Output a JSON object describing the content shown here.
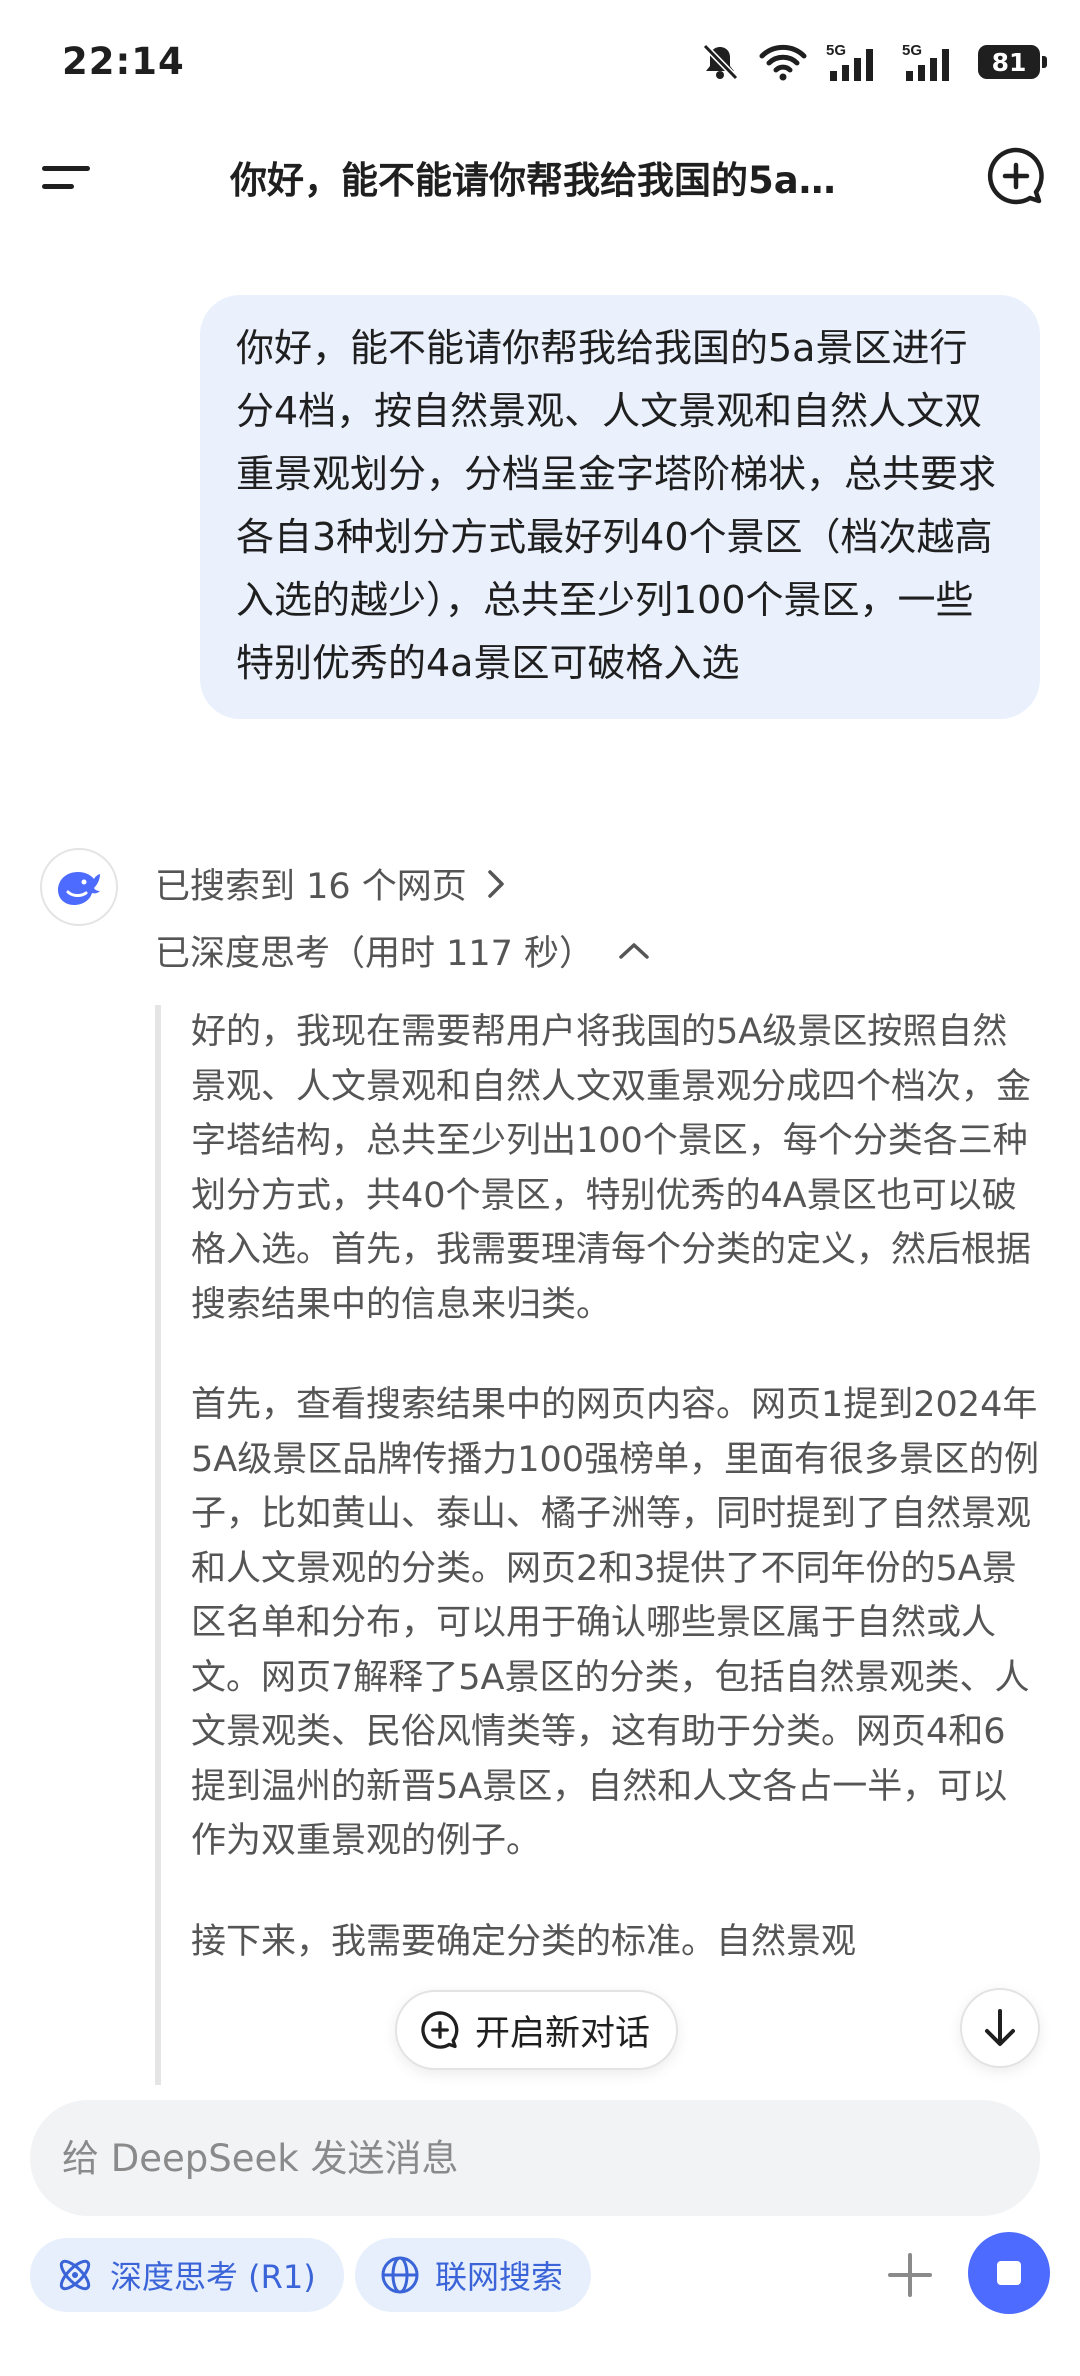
{
  "status_bar": {
    "time": "22:14",
    "battery": "81",
    "network_1": "5G",
    "network_2": "5G",
    "icons": [
      "mute-bell-icon",
      "wifi-icon",
      "signal-icon",
      "signal-icon",
      "battery-icon"
    ]
  },
  "header": {
    "title": "你好，能不能请你帮我给我国的5a景区进行分4档，按自然景观、人文景观和自然人文双重景观划分，分档呈金字塔阶梯状，总共要求各自3种划分方式最好列40个景区（档次越高入选的越少），总共至少列100个景区，一些特别优秀的4a景区可破格入选",
    "menu_icon": "menu-icon",
    "new_chat_icon": "new-chat-icon"
  },
  "user_message": {
    "text": "你好，能不能请你帮我给我国的5a景区进行分4档，按自然景观、人文景观和自然人文双重景观划分，分档呈金字塔阶梯状，总共要求各自3种划分方式最好列40个景区（档次越高入选的越少），总共至少列100个景区，一些特别优秀的4a景区可破格入选"
  },
  "assistant": {
    "search_result": "已搜索到 16 个网页",
    "thinking_label": "已深度思考（用时 117 秒）",
    "thinking_paragraphs": [
      "好的，我现在需要帮用户将我国的5A级景区按照自然景观、人文景观和自然人文双重景观分成四个档次，金字塔结构，总共至少列出100个景区，每个分类各三种划分方式，共40个景区，特别优秀的4A景区也可以破格入选。首先，我需要理清每个分类的定义，然后根据搜索结果中的信息来归类。",
      "首先，查看搜索结果中的网页内容。网页1提到2024年5A级景区品牌传播力100强榜单，里面有很多景区的例子，比如黄山、泰山、橘子洲等，同时提到了自然景观和人文景观的分类。网页2和3提供了不同年份的5A景区名单和分布，可以用于确认哪些景区属于自然或人文。网页7解释了5A景区的分类，包括自然景观类、人文景观类、民俗风情类等，这有助于分类。网页4和6提到温州的新晋5A景区，自然和人文各占一半，可以作为双重景观的例子。",
      "接下来，我需要确定分类的标准。自然景观"
    ]
  },
  "floating": {
    "new_dialog_label": "开启新对话"
  },
  "input": {
    "placeholder": "给 DeepSeek 发送消息"
  },
  "toolbar": {
    "deep_think_label": "深度思考 (R1)",
    "web_search_label": "联网搜索"
  },
  "colors": {
    "accent": "#4d6bfe",
    "chip_bg": "#e7effc",
    "user_bubble": "#eaf1fd"
  }
}
